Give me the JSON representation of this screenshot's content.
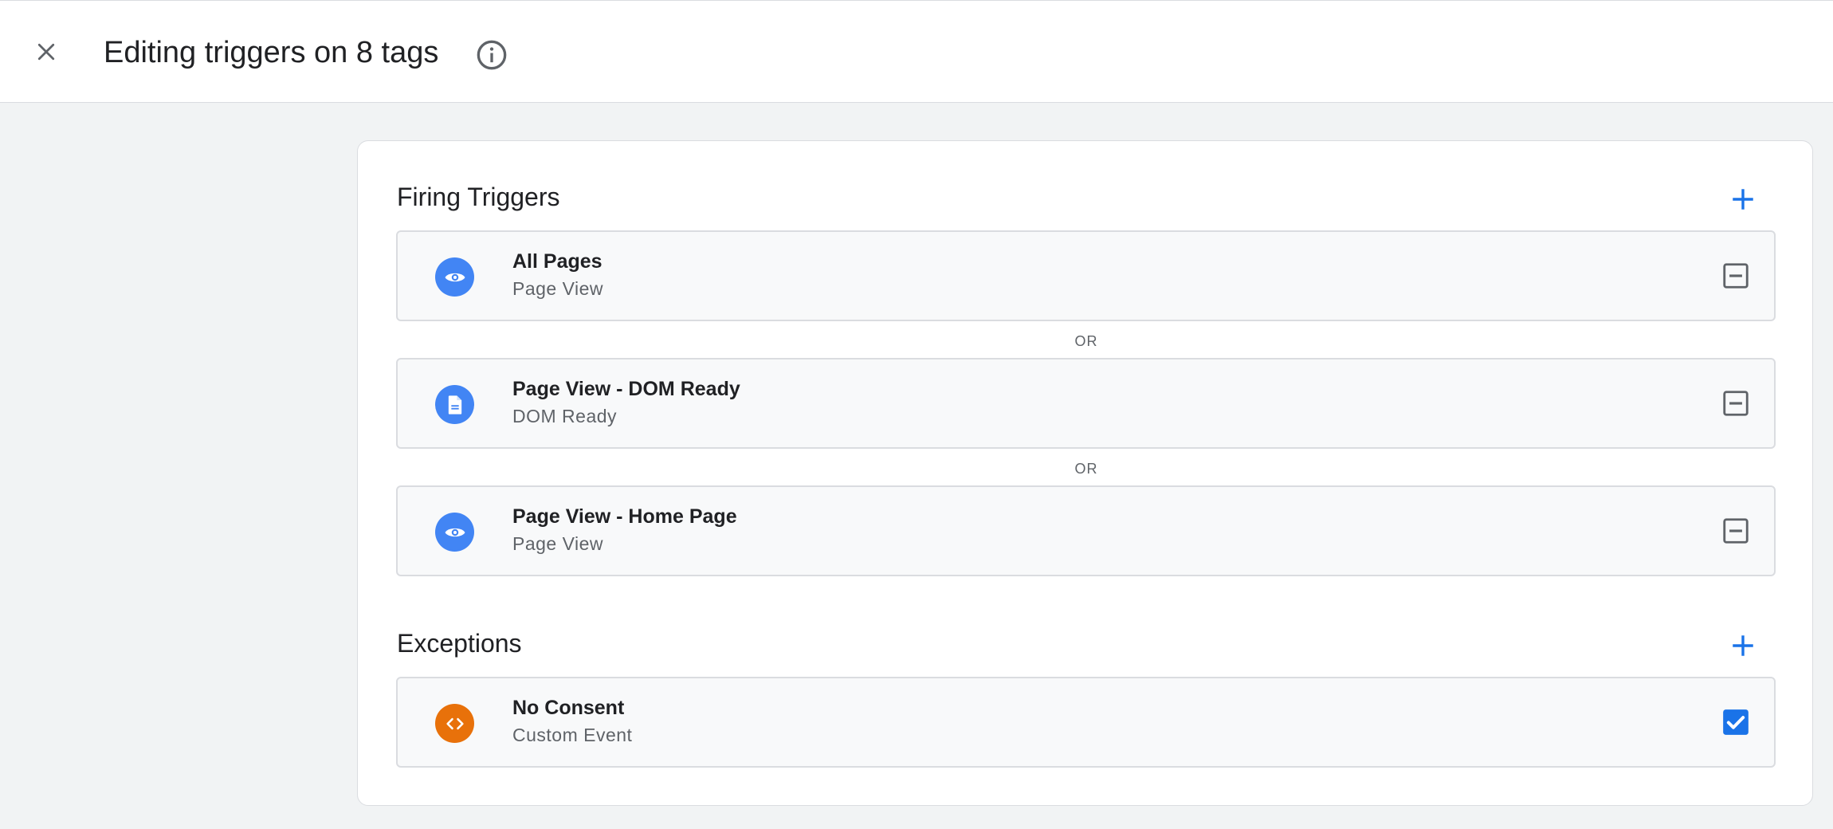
{
  "header": {
    "title": "Editing triggers on 8 tags",
    "close_icon": "close-icon",
    "info_icon": "info-icon"
  },
  "firing": {
    "title": "Firing Triggers",
    "add_icon": "plus-icon",
    "separator": "OR",
    "triggers": [
      {
        "name": "All Pages",
        "type": "Page View",
        "icon": "eye-icon",
        "color": "#4285f4",
        "action": "remove"
      },
      {
        "name": "Page View - DOM Ready",
        "type": "DOM Ready",
        "icon": "document-icon",
        "color": "#4285f4",
        "action": "remove"
      },
      {
        "name": "Page View - Home Page",
        "type": "Page View",
        "icon": "eye-icon",
        "color": "#4285f4",
        "action": "remove"
      }
    ]
  },
  "exceptions": {
    "title": "Exceptions",
    "add_icon": "plus-icon",
    "triggers": [
      {
        "name": "No Consent",
        "type": "Custom Event",
        "icon": "code-icon",
        "color": "#e8710a",
        "action": "checked"
      }
    ]
  },
  "colors": {
    "accent": "#1a73e8",
    "trigger_blue": "#4285f4",
    "trigger_orange": "#e8710a",
    "icon_grey": "#5f6368"
  }
}
